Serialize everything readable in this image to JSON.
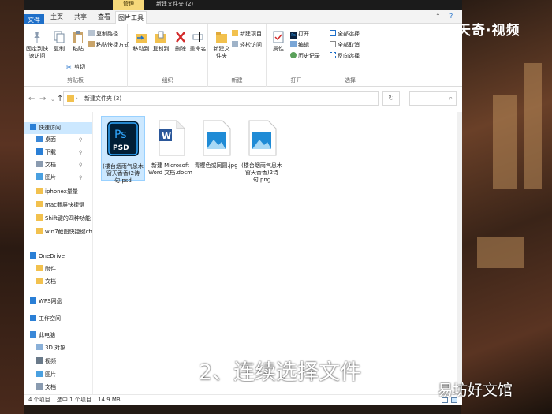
{
  "window": {
    "context_tab": "管理",
    "title": "新建文件夹 (2)",
    "tabs": [
      "文件",
      "主页",
      "共享",
      "查看",
      "图片工具"
    ]
  },
  "ribbon": {
    "clipboard": {
      "pin_label": "固定到快速访问",
      "copy_label": "复制",
      "paste_label": "粘贴",
      "copy_path": "复制路径",
      "paste_shortcut": "粘贴快捷方式",
      "cut_label": "剪切",
      "group_label": "剪贴板"
    },
    "organize": {
      "move_to": "移动到",
      "copy_to": "复制到",
      "delete": "删除",
      "rename": "重命名",
      "group_label": "组织"
    },
    "new": {
      "new_folder": "新建文件夹",
      "new_item": "新建项目",
      "easy_access": "轻松访问",
      "group_label": "新建"
    },
    "open": {
      "properties": "属性",
      "open": "打开",
      "edit": "编辑",
      "history": "历史记录",
      "group_label": "打开"
    },
    "select": {
      "select_all": "全部选择",
      "select_none": "全部取消",
      "invert": "反向选择",
      "group_label": "选择"
    }
  },
  "address": {
    "path": "新建文件夹 (2)",
    "search_icon": "search-icon"
  },
  "nav": {
    "items": [
      {
        "label": "快速访问",
        "icon": "star-icon",
        "selected": true
      },
      {
        "label": "桌面",
        "icon": "desktop-icon"
      },
      {
        "label": "下载",
        "icon": "download-icon"
      },
      {
        "label": "文档",
        "icon": "document-icon"
      },
      {
        "label": "图片",
        "icon": "picture-icon"
      },
      {
        "label": "iphonex量量",
        "icon": "folder-icon"
      },
      {
        "label": "mac截屏快捷键",
        "icon": "folder-icon"
      },
      {
        "label": "Shift键的四种功能",
        "icon": "folder-icon"
      },
      {
        "label": "win7截图快捷键ctr",
        "icon": "folder-icon"
      },
      {
        "label": "OneDrive",
        "icon": "cloud-icon"
      },
      {
        "label": "附件",
        "icon": "folder-icon"
      },
      {
        "label": "文档",
        "icon": "folder-icon"
      },
      {
        "label": "WPS网盘",
        "icon": "wps-cloud-icon"
      },
      {
        "label": "工作空间",
        "icon": "workspace-icon"
      },
      {
        "label": "此电脑",
        "icon": "computer-icon"
      },
      {
        "label": "3D 对象",
        "icon": "cube-icon"
      },
      {
        "label": "视频",
        "icon": "video-icon"
      },
      {
        "label": "图片",
        "icon": "picture-icon"
      },
      {
        "label": "文档",
        "icon": "document-icon"
      }
    ]
  },
  "files": [
    {
      "name": "(楼台烟雨气息木窗天香香)2诗句.psd",
      "type": "psd",
      "selected": true
    },
    {
      "name": "新建 Microsoft Word 文档.docm",
      "type": "word"
    },
    {
      "name": "青樱色或同圆.jpg",
      "type": "image"
    },
    {
      "name": "(楼台烟雨气息木窗天香香)2诗句.png",
      "type": "image"
    }
  ],
  "status": {
    "count": "4 个项目",
    "selected": "选中 1 个项目",
    "size": "14.9 MB"
  },
  "overlay": {
    "logo": "天奇·视频",
    "caption": "2、连续选择文件",
    "watermark": "易坊好文馆"
  },
  "colors": {
    "accent": "#1e6fc9",
    "selection": "#cce8ff",
    "folder": "#f2c14e",
    "ps_blue": "#31a8ff"
  }
}
